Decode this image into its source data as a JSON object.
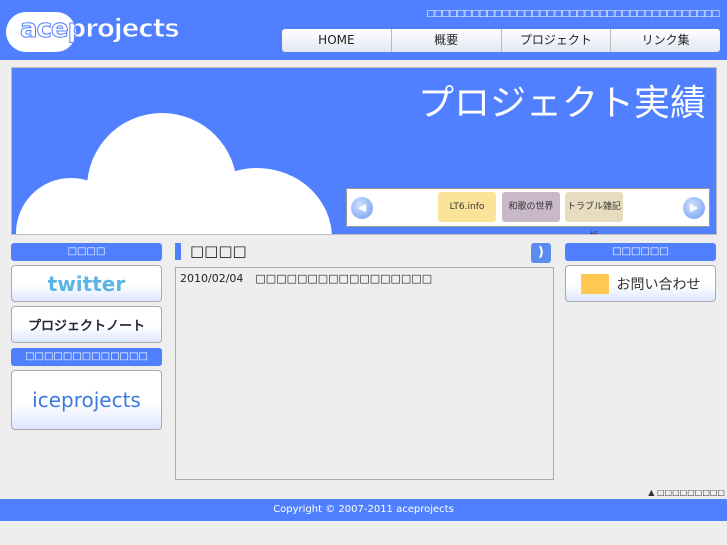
{
  "header": {
    "logo": "aceprojects",
    "tagline": "□□□□□□□□□□□□□□□□□□□□□□□□□□□□□□□□□□□□□□□",
    "nav": [
      "HOME",
      "概要",
      "プロジェクト",
      "リンク集"
    ]
  },
  "banner": {
    "title": "プロジェクト実績",
    "slider": {
      "prev": "◀",
      "next": "▶",
      "items": [
        "LT6.info",
        "和歌の世界",
        "トラブル雑記帳"
      ]
    }
  },
  "left_sidebar": {
    "heading1": "□□□□",
    "twitter": "twitter",
    "project_note": "プロジェクトノート",
    "heading2": "□□□□□□□□□□□□□",
    "iceprojects": "iceprojects"
  },
  "main": {
    "title": "□□□□",
    "rss": "RSS",
    "news": [
      {
        "date": "2010/02/04",
        "text": "□□□□□□□□□□□□□□□□□"
      }
    ]
  },
  "right_sidebar": {
    "heading": "□□□□□□",
    "contact": "お問い合わせ"
  },
  "footer": {
    "copyright": "Copyright © 2007-2011 aceprojects",
    "pagetop": "▲ □□□□□□□□□"
  }
}
